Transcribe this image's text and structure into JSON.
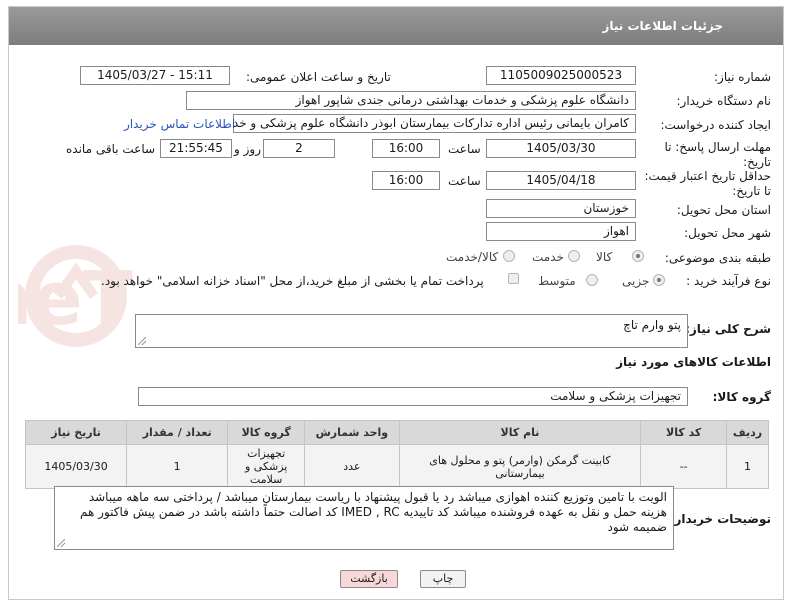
{
  "header": {
    "title": "جزئیات اطلاعات نیاز"
  },
  "fields": {
    "need_number_label": "شماره نیاز:",
    "need_number": "1105009025000523",
    "announce_label": "تاریخ و ساعت اعلان عمومی:",
    "announce_value": "1405/03/27 - 15:11",
    "buyer_org_label": "نام دستگاه خریدار:",
    "buyer_org": "دانشگاه علوم پزشکی و خدمات بهداشتی درمانی جندی شاپور اهواز",
    "requester_label": "ایجاد کننده درخواست:",
    "requester": "کامران بایمانی رئیس اداره تدارکات بیمارستان ابوذر  دانشگاه علوم پزشکی و خدمات بهداشتی",
    "contact_link": "اطلاعات تماس خریدار",
    "deadline_label": "مهلت ارسال پاسخ: تا تاریخ:",
    "deadline_date": "1405/03/30",
    "time_label": "ساعت",
    "deadline_time": "16:00",
    "days_value": "2",
    "days_label": "روز و",
    "remaining_time": "21:55:45",
    "remaining_label": "ساعت باقی مانده",
    "price_validity_label": "حداقل تاریخ اعتبار قیمت: تا تاریخ:",
    "price_date": "1405/04/18",
    "price_time_label": "ساعت",
    "price_time": "16:00",
    "province_label": "استان محل تحویل:",
    "province": "خوزستان",
    "city_label": "شهر محل تحویل:",
    "city": "اهواز",
    "category_label": "طبقه بندی موضوعی:",
    "category_options": [
      "کالا",
      "خدمت",
      "کالا/خدمت"
    ],
    "process_label": "نوع فرآیند خرید :",
    "process_options": [
      "جزیی",
      "متوسط"
    ],
    "payment_note": "پرداخت تمام یا بخشی از مبلغ خرید،از محل \"اسناد خزانه اسلامی\" خواهد بود."
  },
  "description": {
    "label": "شرح کلی نیاز:",
    "value": "پتو وارم تاچ"
  },
  "goods_info_title": "اطلاعات کالاهای مورد نیاز",
  "goods_group": {
    "label": "گروه کالا:",
    "value": "تجهیزات پزشکی و سلامت"
  },
  "table": {
    "headers": [
      "ردیف",
      "کد کالا",
      "نام کالا",
      "واحد شمارش",
      "گروه کالا",
      "تعداد / مقدار",
      "تاریخ نیاز"
    ],
    "rows": [
      {
        "row": "1",
        "code": "--",
        "name": "کابینت گرمکن (وارمر) پتو و محلول های بیمارستانی",
        "unit": "عدد",
        "group": "تجهیزات پزشکی و سلامت",
        "qty": "1",
        "date": "1405/03/30"
      }
    ]
  },
  "buyer_notes": {
    "label": "توضیحات خریدار:",
    "value": "الویت با تامین وتوزیع کننده اهوازی میباشد رد یا قبول پیشنهاد با ریاست بیمارستان میباشد / پرداختی سه ماهه میباشد هزینه حمل و نقل به عهده فروشنده میباشد کد تاییدیه IMED , RC کد اصالت حتماً داشته باشد در ضمن پیش فاکتور هم ضمیمه شود"
  },
  "buttons": {
    "print": "چاپ",
    "back": "بازگشت"
  },
  "watermark_text": "AriaTender.neT",
  "colors": {
    "link": "#2a55b5",
    "header_bg": "#8a8a8a",
    "back_button": "#f7d7d7"
  }
}
